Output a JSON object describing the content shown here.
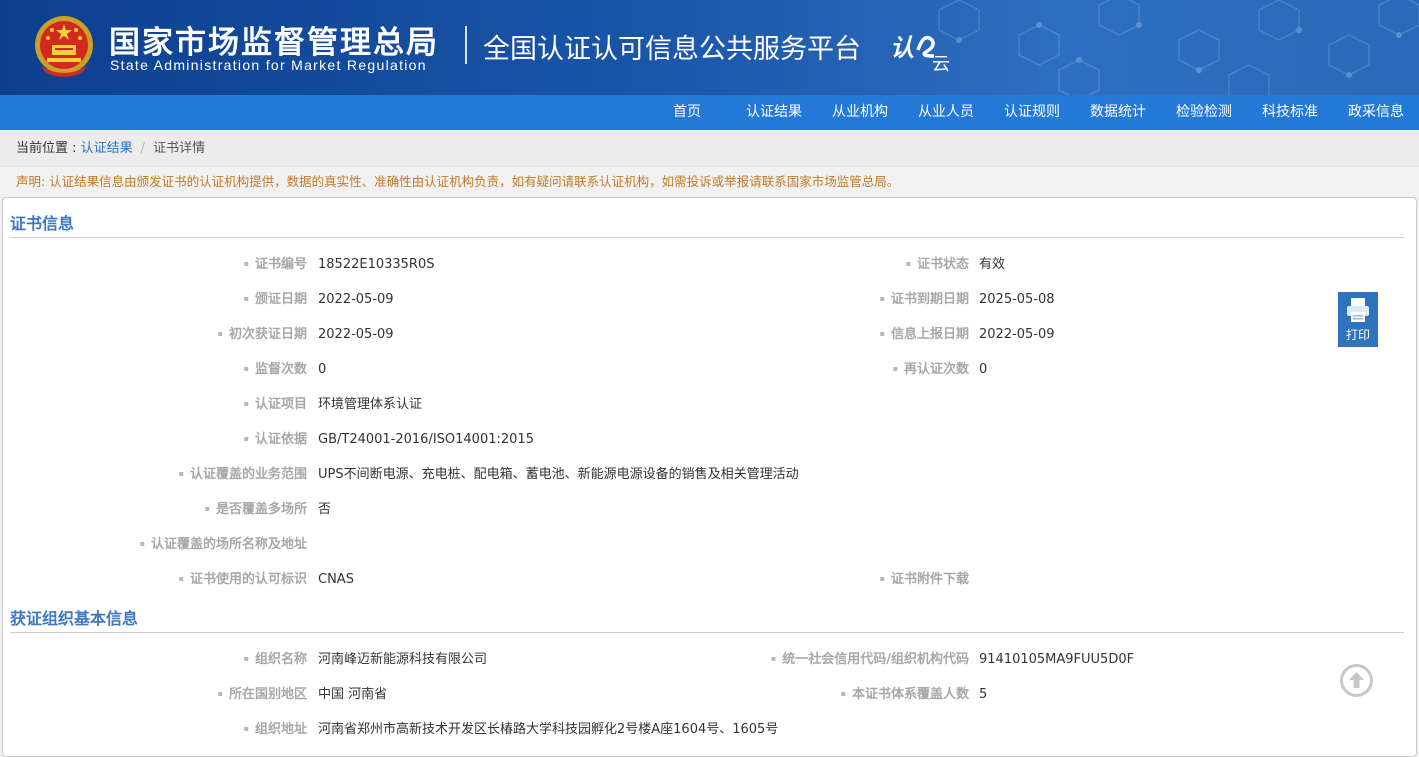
{
  "header": {
    "org_cn": "国家市场监督管理总局",
    "org_en": "State Administration  for  Market Regulation",
    "platform": "全国认证认可信息公共服务平台",
    "logo_text": "认e云"
  },
  "nav": [
    "首页",
    "认证结果",
    "从业机构",
    "从业人员",
    "认证规则",
    "数据统计",
    "检验检测",
    "科技标准",
    "政采信息"
  ],
  "breadcrumb": {
    "prefix": "当前位置 : ",
    "parent": "认证结果",
    "current": "证书详情"
  },
  "notice": "声明: 认证结果信息由颁发证书的认证机构提供，数据的真实性、准确性由认证机构负责，如有疑问请联系认证机构，如需投诉或举报请联系国家市场监管总局。",
  "certificate": {
    "title": "证书信息",
    "fields": [
      {
        "label": "证书编号",
        "value": "18522E10335R0S"
      },
      {
        "label": "证书状态",
        "value": "有效"
      },
      {
        "label": "颁证日期",
        "value": "2022-05-09"
      },
      {
        "label": "证书到期日期",
        "value": "2025-05-08"
      },
      {
        "label": "初次获证日期",
        "value": "2022-05-09"
      },
      {
        "label": "信息上报日期",
        "value": "2022-05-09"
      },
      {
        "label": "监督次数",
        "value": "0"
      },
      {
        "label": "再认证次数",
        "value": "0"
      },
      {
        "label": "认证项目",
        "value": "环境管理体系认证"
      },
      {
        "label": "认证依据",
        "value": "GB/T24001-2016/ISO14001:2015"
      },
      {
        "label": "认证覆盖的业务范围",
        "value": "UPS不间断电源、充电桩、配电箱、蓄电池、新能源电源设备的销售及相关管理活动"
      },
      {
        "label": "是否覆盖多场所",
        "value": "否"
      },
      {
        "label": "认证覆盖的场所名称及地址",
        "value": ""
      },
      {
        "label": "证书使用的认可标识",
        "value": "CNAS"
      },
      {
        "label": "证书附件下载",
        "value": ""
      }
    ]
  },
  "organization": {
    "title": "获证组织基本信息",
    "fields": [
      {
        "label": "组织名称",
        "value": "河南峰迈新能源科技有限公司"
      },
      {
        "label": "统一社会信用代码/组织机构代码",
        "value": "91410105MA9FUU5D0F"
      },
      {
        "label": "所在国别地区",
        "value": "中国 河南省"
      },
      {
        "label": "本证书体系覆盖人数",
        "value": "5"
      },
      {
        "label": "组织地址",
        "value": "河南省郑州市高新技术开发区长椿路大学科技园孵化2号楼A座1604号、1605号"
      }
    ]
  },
  "print_label": "打印",
  "icons": {
    "emblem": "national-emblem-icon",
    "print": "printer-icon",
    "top": "back-to-top-icon"
  },
  "colors": {
    "header_blue": "#1a55a8",
    "nav_blue": "#2479d8",
    "section_title": "#3d78c2",
    "notice": "#c07a28"
  }
}
